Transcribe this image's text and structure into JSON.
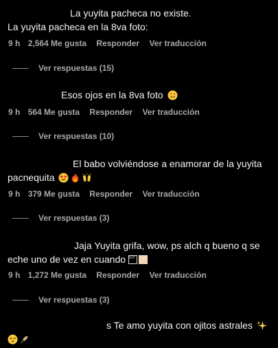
{
  "comments": [
    {
      "lines": [
        "La yuyita pacheca no existe.",
        "La yuyita pacheca en la 8va foto:"
      ],
      "time": "9 h",
      "likes": "2,564 Me gusta",
      "reply": "Responder",
      "translate": "Ver traducción",
      "replies": "Ver respuestas (15)"
    },
    {
      "lines": [
        "Esos ojos en la 8va foto"
      ],
      "emoji": [
        "smiling-face-icon"
      ],
      "time": "9 h",
      "likes": "564 Me gusta",
      "reply": "Responder",
      "translate": "Ver traducción",
      "replies": "Ver respuestas (10)"
    },
    {
      "lines": [
        "El babo volviéndose a enamorar de la yuyita",
        "pacnequita"
      ],
      "emoji": [
        "heart-eyes-icon",
        "fire-icon",
        "raised-hands-icon"
      ],
      "time": "9 h",
      "likes": "379 Me gusta",
      "reply": "Responder",
      "translate": "Ver traducción",
      "replies": "Ver respuestas (3)"
    },
    {
      "lines": [
        "Jaja Yuyita grifa, wow, ps alch q bueno q se",
        "eche uno de vez en cuando"
      ],
      "codebox": "01F 90C",
      "time": "9 h",
      "likes": "1,272 Me gusta",
      "reply": "Responder",
      "translate": "Ver traducción",
      "replies": "Ver respuestas (3)"
    },
    {
      "lines": [
        "s Te amo yuyita con ojitos astrales"
      ],
      "emoji": [
        "sparkles-icon",
        "dizzy-face-icon",
        "herb-icon"
      ]
    }
  ],
  "colors": {
    "background": "#000000",
    "text": "#f5f5f5",
    "meta": "#a8a8a8"
  }
}
